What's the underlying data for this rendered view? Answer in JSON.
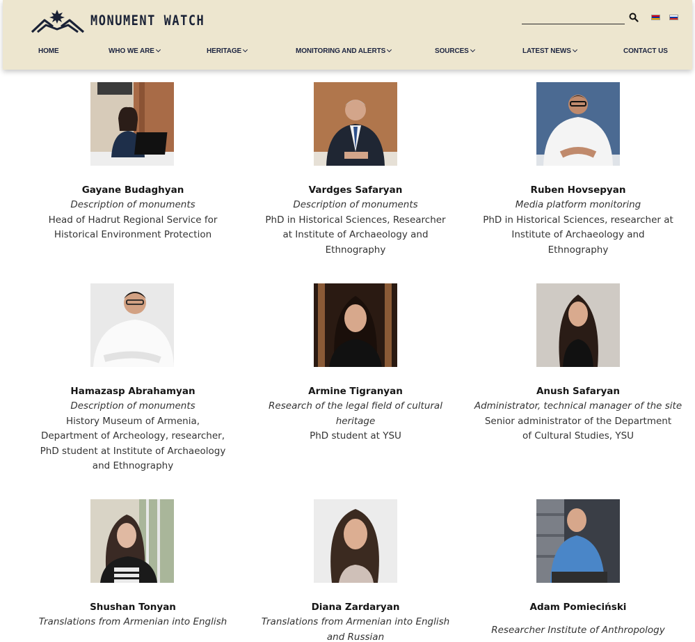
{
  "header": {
    "logo_text": "MONUMENT WATCH",
    "search_placeholder": "",
    "languages": [
      "hy",
      "ru"
    ]
  },
  "nav": {
    "items": [
      {
        "label": "HOME",
        "dropdown": false
      },
      {
        "label": "WHO WE ARE",
        "dropdown": true
      },
      {
        "label": "HERITAGE",
        "dropdown": true
      },
      {
        "label": "MONITORING AND ALERTS",
        "dropdown": true
      },
      {
        "label": "SOURCES",
        "dropdown": true
      },
      {
        "label": "LATEST NEWS",
        "dropdown": true
      },
      {
        "label": "CONTACT US",
        "dropdown": false
      }
    ]
  },
  "team": [
    {
      "name": "Gayane Budaghyan",
      "role": "Description of monuments",
      "desc": [
        "Head of Hadrut Regional Service for",
        "Historical Environment Protection"
      ]
    },
    {
      "name": "Vardges Safaryan",
      "role": "Description of monuments",
      "desc": [
        "PhD in Historical Sciences, Researcher",
        "at  Institute of Archaeology and",
        "Ethnography"
      ]
    },
    {
      "name": "Ruben Hovsepyan",
      "role": "Media platform monitoring",
      "desc": [
        "PhD in Historical Sciences,  researcher at",
        "Institute of Archaeology and",
        "Ethnography"
      ]
    },
    {
      "name": "Hamazasp Abrahamyan",
      "role": "Description of monuments",
      "desc": [
        "History Museum of Armenia,",
        "Department of Archeology, researcher,",
        "PhD student at Institute of Archaeology",
        "and Ethnography"
      ]
    },
    {
      "name": "Armine Tigranyan",
      "role": "Research of the legal field of cultural heritage",
      "desc": [
        "PhD student at YSU"
      ]
    },
    {
      "name": "Anush Safaryan",
      "role": "Administrator, technical manager of the site",
      "desc": [
        "Senior administrator of the Department",
        "of Cultural Studies, YSU"
      ]
    },
    {
      "name": "Shushan Tonyan",
      "role": "Translations from Armenian into English",
      "desc": []
    },
    {
      "name": "Diana Zardaryan",
      "role": "Translations from Armenian into English and Russian",
      "desc": []
    },
    {
      "name": "Adam Pomieciński",
      "role": "",
      "desc": [
        "Researcher Institute of Anthropology"
      ]
    }
  ],
  "colors": {
    "header_bg": "#ede6cf",
    "nav_text": "#1c2440",
    "logo": "#1a2236"
  }
}
